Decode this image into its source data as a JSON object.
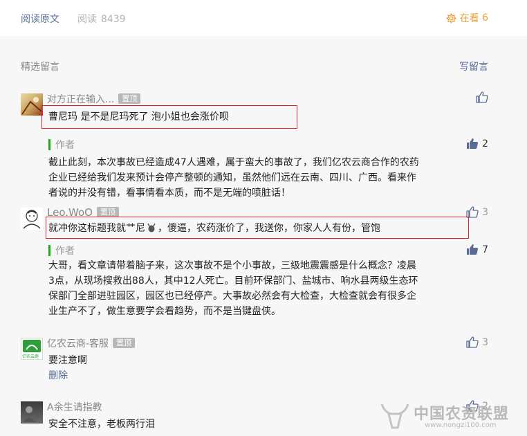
{
  "topbar": {
    "read_original": "阅读原文",
    "read_label": "阅读",
    "read_count": "8439",
    "zaikan_label": "在看",
    "zaikan_count": "6"
  },
  "section": {
    "title": "精选留言",
    "write": "写留言"
  },
  "badge_pinned": "置顶",
  "author_label": "作者",
  "delete_label": "删除",
  "comments": [
    {
      "nick": "对方正在输入...",
      "text": "曹尼玛 是不是尼玛死了 泡小姐也会涨价呗",
      "likes": "",
      "reply_likes": "2",
      "reply": [
        "截止此刻，本次事故已经造成47人遇难，属于蛮大的事故了，我们亿农云商合作的农药",
        "企业已经给我们发来预计会停产整顿的通知，虽然他们远在云南、四川、广西。看来作",
        "者说的并没有错，看事情看本质，而不是无端的喷脏话！"
      ]
    },
    {
      "nick": "Leo.WoO",
      "text": "就冲你这标题我就艹尼",
      "text_tail": "，傻逼，农药涨价了，我送你，你家人人有份，管饱",
      "likes": "3",
      "reply_likes": "7",
      "reply": [
        "大哥，看文章请带着脑子来，这次事故不是个小事故，三级地震震感是什么概念？凌晨",
        "3点，从现场搜救出88人，其中12人死亡。目前环保部门、盐城市、响水县两级生态环",
        "保部门全部进驻园区，园区也已经停产。大事故必然会有大检查，大检查就会有很多企",
        "业生产不了，做生意要学会看趋势，而不是当键盘侠。"
      ]
    },
    {
      "nick": "亿农云商-客服",
      "avatar_text": "亿农云商",
      "text": "要注意啊",
      "likes": "3"
    },
    {
      "nick": "A余生请指教",
      "text": "安全不注意，老板两行泪",
      "likes": "2"
    }
  ],
  "watermark": {
    "name": "中国农资联盟",
    "url": "www.nongzi100.com"
  },
  "colors": {
    "link": "#576b95",
    "accent": "#e6a23c",
    "reply_bar": "#1aad19",
    "highlight_box": "#d9262d",
    "background": "#f7f7f7"
  }
}
